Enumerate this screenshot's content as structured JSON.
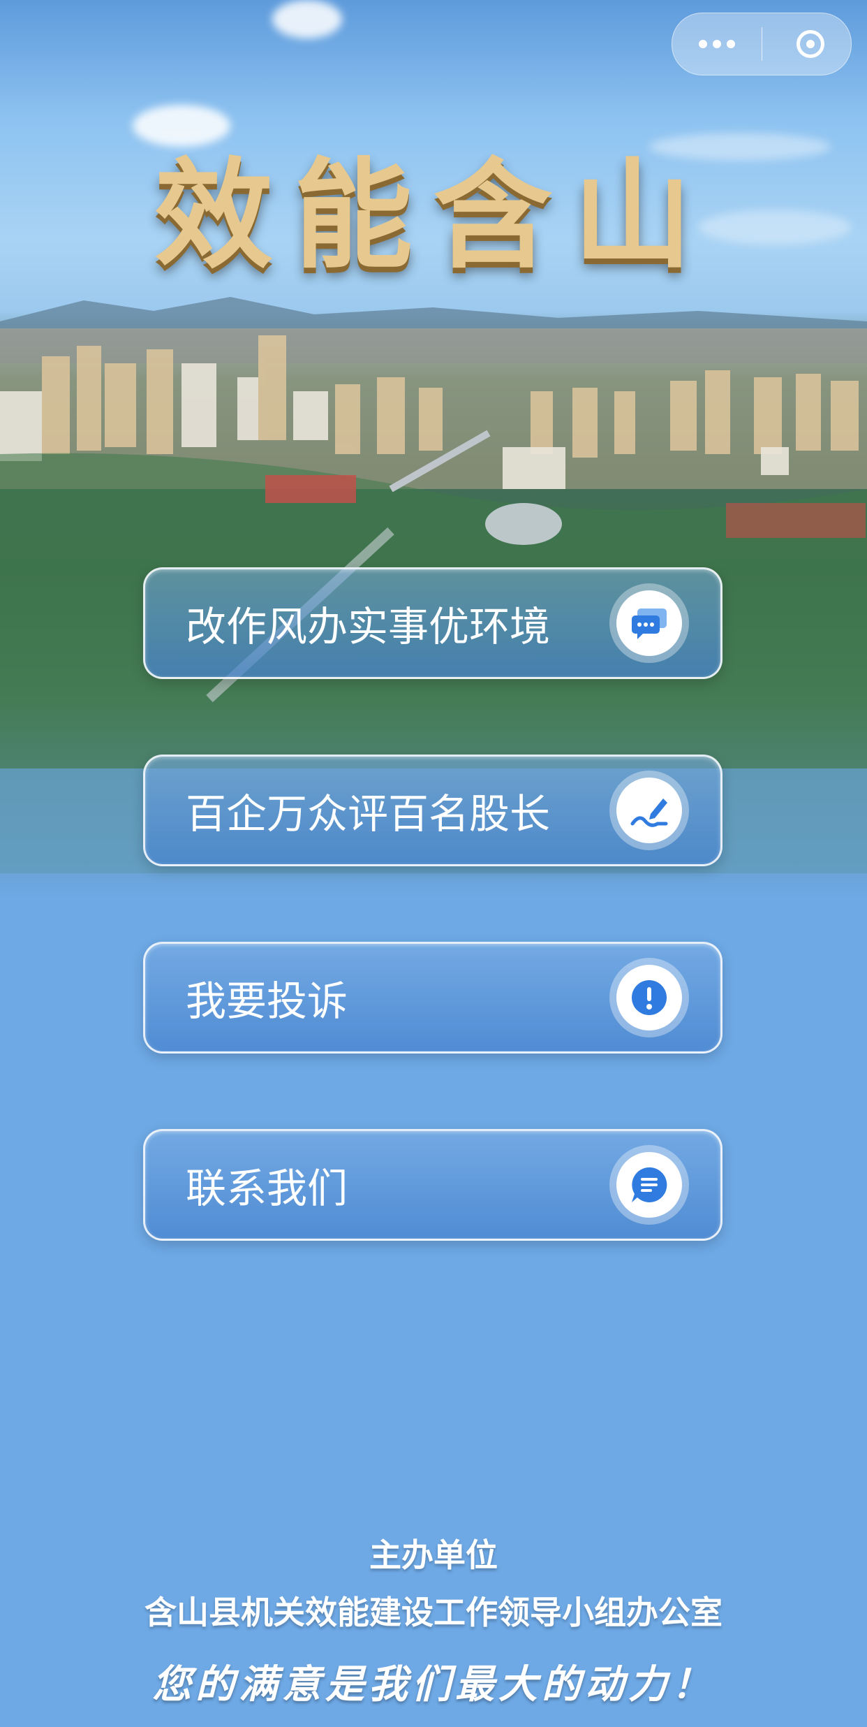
{
  "app": {
    "title": "效能含山"
  },
  "menu": [
    {
      "label": "改作风办实事优环境",
      "icon": "chat-bubbles-icon"
    },
    {
      "label": "百企万众评百名股长",
      "icon": "pen-sign-icon"
    },
    {
      "label": "我要投诉",
      "icon": "exclamation-icon"
    },
    {
      "label": "联系我们",
      "icon": "message-icon"
    }
  ],
  "footer": {
    "organizer_label": "主办单位",
    "organizer_name": "含山县机关效能建设工作领导小组办公室",
    "slogan": "您的满意是我们最大的动力！"
  },
  "colors": {
    "page_blue": "#6ea9e6",
    "title_gold": "#e7c98f",
    "icon_blue": "#2f7be0"
  }
}
